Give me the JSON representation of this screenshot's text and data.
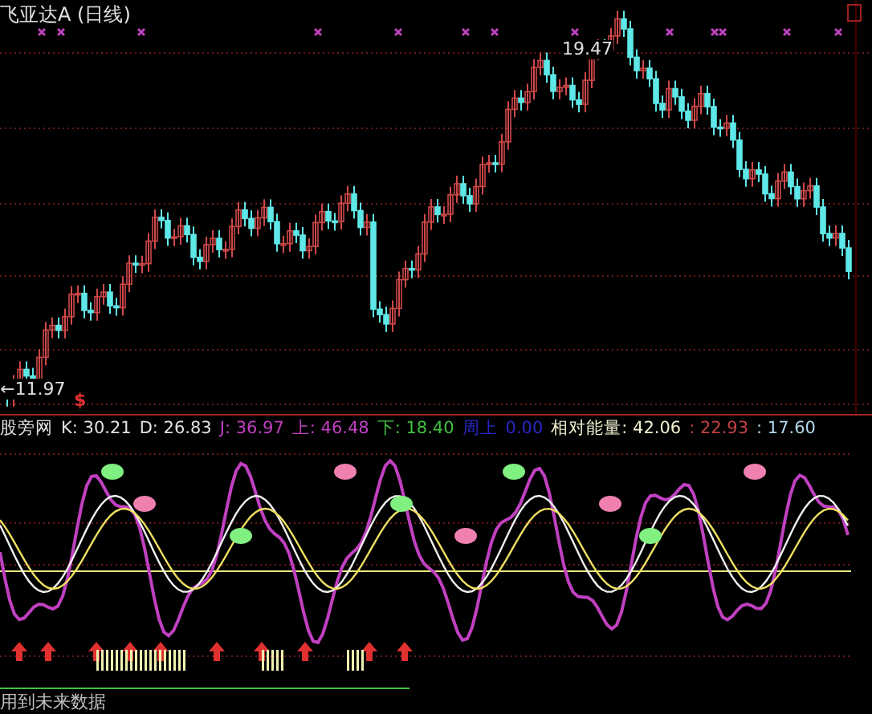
{
  "price_panel": {
    "title": "飞亚达A (日线)",
    "high_label": "19.47",
    "low_label": "←11.97",
    "signal_mark": "$"
  },
  "indicator_legend": [
    {
      "text": "股旁网",
      "color": "#e0e0e0"
    },
    {
      "text": "K: 30.21",
      "color": "#e0e0e0"
    },
    {
      "text": "D: 26.83",
      "color": "#e0e0e0"
    },
    {
      "text": "J: 36.97",
      "color": "#c040c0"
    },
    {
      "text": "上: 46.48",
      "color": "#c040c0"
    },
    {
      "text": "下: 18.40",
      "color": "#40c040"
    },
    {
      "text": "周上",
      "color": "#2828c8"
    },
    {
      "text": "0.00",
      "color": "#2828c8"
    },
    {
      "text": "相对能量: 42.06",
      "color": "#f0f0d0"
    },
    {
      "text": ": 22.93",
      "color": "#c04040"
    },
    {
      "text": ": 17.60",
      "color": "#b0d8e8"
    }
  ],
  "footer_note": "用到未来数据"
}
